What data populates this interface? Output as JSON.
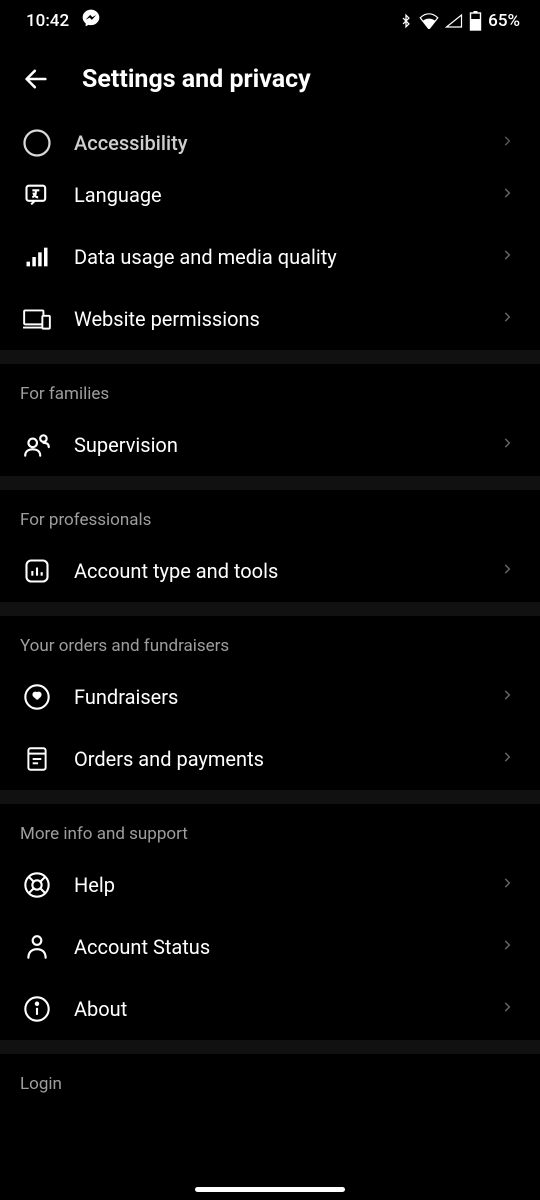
{
  "status": {
    "time": "10:42",
    "battery": "65%"
  },
  "header": {
    "title": "Settings and privacy"
  },
  "partial_top_item": {
    "label": "Accessibility"
  },
  "top_items": [
    {
      "label": "Language"
    },
    {
      "label": "Data usage and media quality"
    },
    {
      "label": "Website permissions"
    }
  ],
  "sections": [
    {
      "header": "For families",
      "items": [
        {
          "label": "Supervision"
        }
      ]
    },
    {
      "header": "For professionals",
      "items": [
        {
          "label": "Account type and tools"
        }
      ]
    },
    {
      "header": "Your orders and fundraisers",
      "items": [
        {
          "label": "Fundraisers"
        },
        {
          "label": "Orders and payments"
        }
      ]
    },
    {
      "header": "More info and support",
      "items": [
        {
          "label": "Help"
        },
        {
          "label": "Account Status"
        },
        {
          "label": "About"
        }
      ]
    },
    {
      "header": "Login",
      "items": []
    }
  ]
}
